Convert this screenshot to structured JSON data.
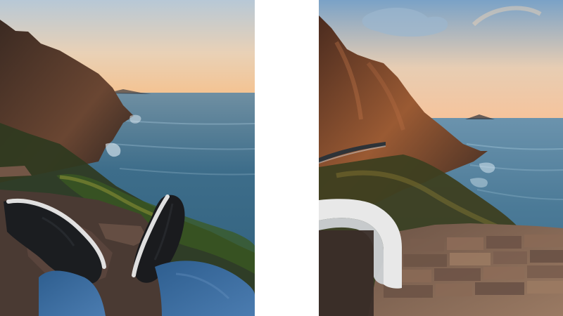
{
  "layout": {
    "background": "#ffffff"
  },
  "photos": [
    {
      "scene": "cliffside-coast-feet-view",
      "palette": {
        "sky_top": "#b9c9d6",
        "sky_horizon": "#f2c89b",
        "sea": "#3f6f8c",
        "cliff": "#5a3a2a",
        "shoe": "#1b1d20",
        "jeans": "#3f6ea0"
      }
    },
    {
      "scene": "coastal-road-stone-wall-view",
      "palette": {
        "sky_top": "#8fb3d3",
        "sky_horizon": "#f7c99c",
        "sea": "#4f7f9b",
        "cliff": "#7a4a2c",
        "wall": "#8c6a55",
        "ledge": "#e7e7e7"
      }
    }
  ]
}
